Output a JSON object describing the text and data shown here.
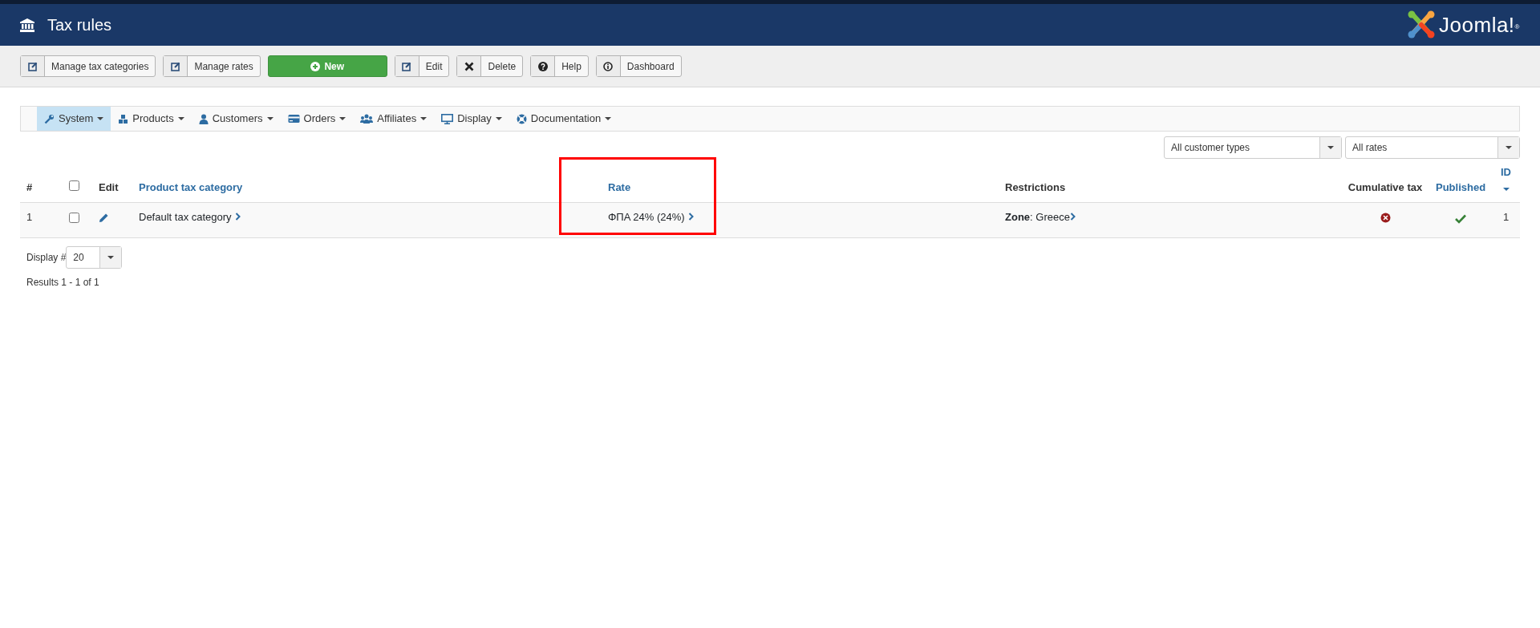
{
  "header": {
    "title": "Tax rules",
    "logo_text": "Joomla!$^{®}$"
  },
  "toolbar": [
    {
      "label": "Manage tax categories",
      "kind": "default"
    },
    {
      "label": "Manage rates",
      "kind": "default"
    },
    {
      "label": "New",
      "kind": "primary"
    },
    {
      "label": "Edit",
      "kind": "default"
    },
    {
      "label": "Delete",
      "kind": "default"
    },
    {
      "label": "Help",
      "kind": "default"
    },
    {
      "label": "Dashboard",
      "kind": "default"
    }
  ],
  "menu": [
    {
      "label": "System",
      "selected": true
    },
    {
      "label": "Products",
      "selected": false
    },
    {
      "label": "Customers",
      "selected": false
    },
    {
      "label": "Orders",
      "selected": false
    },
    {
      "label": "Affiliates",
      "selected": false
    },
    {
      "label": "Display",
      "selected": false
    },
    {
      "label": "Documentation",
      "selected": false
    }
  ],
  "filters": [
    {
      "value": "All customer types"
    },
    {
      "value": "All rates"
    }
  ],
  "table": {
    "columns": [
      {
        "kind": "text",
        "label": "#"
      },
      {
        "kind": "checkbox",
        "checked": false
      },
      {
        "kind": "text",
        "label": "Edit"
      },
      {
        "kind": "link",
        "label": "Product tax category"
      },
      {
        "kind": "link",
        "label": "Rate",
        "highlighted": true
      },
      {
        "kind": "text",
        "label": "Restrictions"
      },
      {
        "kind": "text",
        "label": "Cumulative tax"
      },
      {
        "kind": "link",
        "label": "Published"
      },
      {
        "kind": "sorted",
        "label": "ID"
      }
    ],
    "rows": [
      {
        "number": "1",
        "checked": false,
        "category": "Default tax category",
        "rate": "ΦΠΑ 24% (24%)",
        "restriction": "**Zone**: Greece",
        "cumulative": false,
        "published": true,
        "id": "1"
      }
    ]
  },
  "pagination": {
    "label": "Display #",
    "limit": "20",
    "results": "Results 1 - 1 of 1"
  }
}
